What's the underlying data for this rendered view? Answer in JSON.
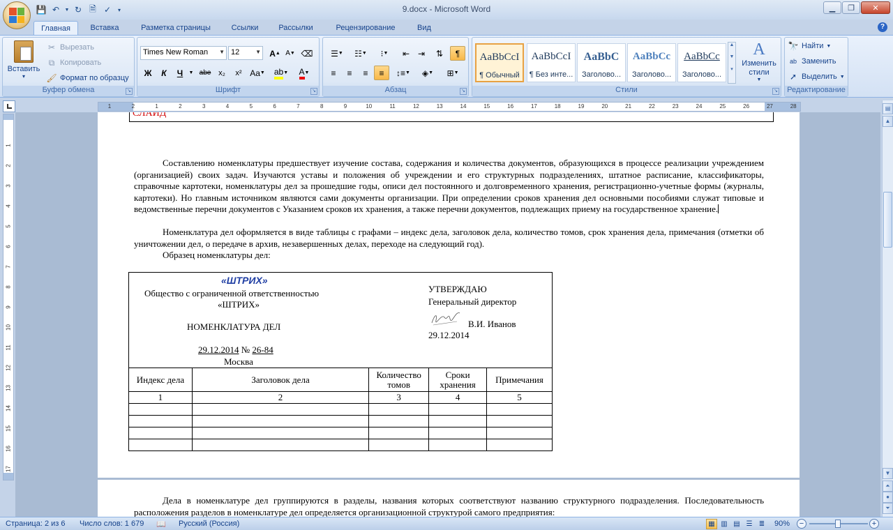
{
  "window": {
    "title": "9.docx - Microsoft Word"
  },
  "ribbon_tabs": [
    "Главная",
    "Вставка",
    "Разметка страницы",
    "Ссылки",
    "Рассылки",
    "Рецензирование",
    "Вид"
  ],
  "clipboard": {
    "label": "Буфер обмена",
    "paste": "Вставить",
    "cut": "Вырезать",
    "copy": "Копировать",
    "format_painter": "Формат по образцу"
  },
  "font": {
    "label": "Шрифт",
    "name": "Times New Roman",
    "size": "12",
    "bold": "Ж",
    "italic": "К",
    "underline": "Ч",
    "strike": "abe",
    "subscript": "x₂",
    "superscript": "x²",
    "case": "Aa",
    "grow": "A",
    "shrink": "A"
  },
  "paragraph": {
    "label": "Абзац"
  },
  "styles": {
    "label": "Стили",
    "items": [
      {
        "sample": "AaBbCcI",
        "name": "¶ Обычный"
      },
      {
        "sample": "AaBbCcI",
        "name": "¶ Без инте..."
      },
      {
        "sample": "AaBbC",
        "name": "Заголово..."
      },
      {
        "sample": "AaBbCc",
        "name": "Заголово..."
      },
      {
        "sample": "AaBbCc",
        "name": "Заголово..."
      }
    ],
    "change_styles": "Изменить стили"
  },
  "editing": {
    "label": "Редактирование",
    "find": "Найти",
    "replace": "Заменить",
    "select": "Выделить"
  },
  "ruler": {
    "ticks": [
      "1",
      "2",
      "1",
      "2",
      "3",
      "4",
      "5",
      "6",
      "7",
      "8",
      "9",
      "10",
      "11",
      "12",
      "13",
      "14",
      "15",
      "16",
      "17",
      "18",
      "19",
      "20",
      "21",
      "22",
      "23",
      "24",
      "25",
      "26",
      "27",
      "28"
    ],
    "vticks": [
      "1",
      "2",
      "3",
      "4",
      "5",
      "6",
      "7",
      "8",
      "9",
      "10",
      "11",
      "12",
      "13",
      "14",
      "15",
      "16",
      "17"
    ]
  },
  "document": {
    "slide_word": "СЛАЙД",
    "paragraph1": "Составлению номенклатуры предшествует изучение состава, содержания и количества документов, образующихся в процессе реализации учреждением (организацией) своих задач. Изучаются уставы и положения об учреждении и его структурных подразделениях, штатное расписание, классификаторы, справочные картотеки, номенклатуры дел за прошедшие годы, описи дел постоянного и долговременного хранения, регистрационно-учетные формы (журналы, картотеки). Но главным источником являются сами документы организации. При определении сроков хранения дел основными пособиями служат типовые и ведомственные перечни документов с Указанием сроков их хранения, а также перечни документов, подлежащих приему на государственное хранение.",
    "paragraph2": "Номенклатура дел оформляется в виде таблицы с графами – индекс дела, заголовок дела, количество томов, срок хранения дела, примечания (отметки об уничтожении дел, о передаче в архив, незавершенных делах, переходе на следующий год).",
    "paragraph3": "Образец номенклатуры дел:",
    "sample": {
      "logo": "«ШТРИХ»",
      "org_line1": "Общество с ограниченной ответственностью",
      "org_line2": "«ШТРИХ»",
      "doc_title": "НОМЕНКЛАТУРА  ДЕЛ",
      "date": "29.12.2014",
      "number_sign": "№",
      "number": "26-84",
      "city": "Москва",
      "approve": "УТВЕРЖДАЮ",
      "position": "Генеральный директор",
      "signer": "В.И. Иванов",
      "approve_date": "29.12.2014",
      "headers": [
        "Индекс дела",
        "Заголовок дела",
        "Количество томов",
        "Сроки хранения",
        "Примечания"
      ],
      "col_numbers": [
        "1",
        "2",
        "3",
        "4",
        "5"
      ]
    },
    "page2_paragraph": "Дела в номенклатуре дел группируются в разделы, названия которых соответствуют названию структурного подразделения. Последовательность расположения разделов в номенклатуре дел определяется организационной структурой самого предприятия:"
  },
  "status": {
    "page": "Страница: 2 из 6",
    "words": "Число слов: 1 679",
    "language": "Русский (Россия)",
    "zoom": "90%"
  }
}
